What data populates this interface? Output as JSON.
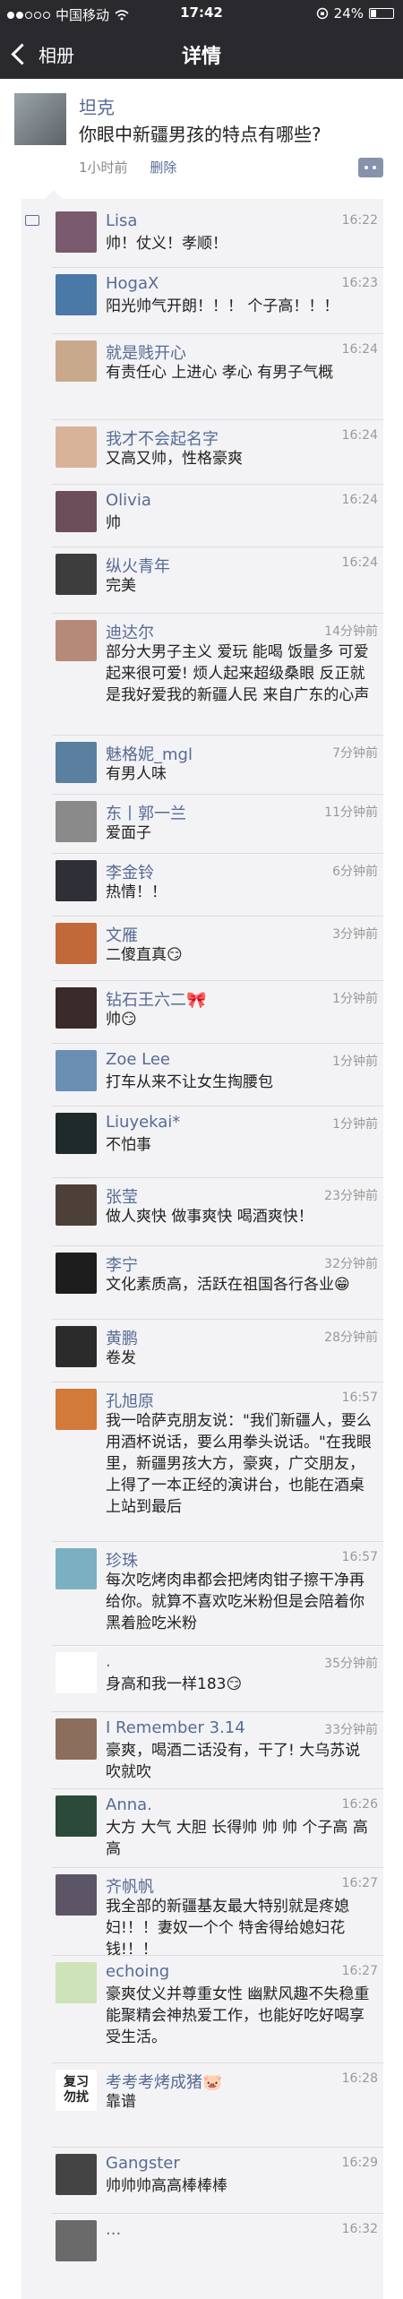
{
  "status": {
    "carrier": "中国移动",
    "time": "17:42",
    "battery": "24%",
    "battery_level": 0.24
  },
  "nav": {
    "back_label": "相册",
    "title": "详情"
  },
  "post": {
    "author": "坦克",
    "text": "你眼中新疆男孩的特点有哪些?",
    "time": "1小时前",
    "delete_label": "删除"
  },
  "comments": [
    {
      "name": "Lisa",
      "time": "16:22",
      "text": "帅！仗义！孝顺！",
      "color": "#7a5a6e"
    },
    {
      "name": "HogaX",
      "time": "16:23",
      "text": "阳光帅气开朗！！！ 个子高！！！",
      "color": "#4a79a8"
    },
    {
      "name": "就是贱开心",
      "time": "16:24",
      "text": "有责任心 上进心 孝心 有男子气概",
      "color": "#c9a98c"
    },
    {
      "name": "我才不会起名字",
      "time": "16:24",
      "text": "又高又帅，性格豪爽",
      "color": "#d8b39a"
    },
    {
      "name": "Olivia",
      "time": "16:24",
      "text": "帅",
      "color": "#6b4e5a"
    },
    {
      "name": "纵火青年",
      "time": "16:24",
      "text": "完美",
      "color": "#3d3d3d"
    },
    {
      "name": "迪达尔",
      "time": "14分钟前",
      "text": "部分大男子主义 爱玩 能喝 饭量多 可爱起来很可爱! 烦人起来超级桑眼 反正就是我好爱我的新疆人民 来自广东的心声",
      "color": "#b58a78"
    },
    {
      "name": "魅格妮_mgl",
      "time": "7分钟前",
      "text": "有男人味",
      "color": "#5b7f9e"
    },
    {
      "name": "东丨郭一兰",
      "time": "11分钟前",
      "text": "爱面子",
      "color": "#8a8a8a"
    },
    {
      "name": "李金铃",
      "time": "6分钟前",
      "text": "热情！！",
      "color": "#2f2f38"
    },
    {
      "name": "文雁",
      "time": "3分钟前",
      "text": "二傻直真😏",
      "color": "#c2693a"
    },
    {
      "name": "钻石王六二🎀",
      "time": "1分钟前",
      "text": "帅😏",
      "color": "#3a2a2a"
    },
    {
      "name": "Zoe Lee",
      "time": "1分钟前",
      "text": "打车从来不让女生掏腰包",
      "color": "#6a8fb3"
    },
    {
      "name": "Liuyekai*",
      "time": "1分钟前",
      "text": "不怕事",
      "color": "#1f2a2a"
    },
    {
      "name": "张莹",
      "time": "23分钟前",
      "text": "做人爽快 做事爽快 喝酒爽快！",
      "color": "#4d4038"
    },
    {
      "name": "李宁",
      "time": "32分钟前",
      "text": "文化素质高，活跃在祖国各行各业😁",
      "color": "#1d1d1d"
    },
    {
      "name": "黄鹏",
      "time": "28分钟前",
      "text": "卷发",
      "color": "#2b2b2b"
    },
    {
      "name": "孔旭原",
      "time": "16:57",
      "text": "我一哈萨克朋友说：\"我们新疆人，要么用酒杯说话，要么用拳头说话。\"在我眼里，新疆男孩大方，豪爽，广交朋友，上得了一本正经的演讲台，也能在酒桌上站到最后",
      "color": "#d27a3a"
    },
    {
      "name": "珍珠",
      "time": "16:57",
      "text": "每次吃烤肉串都会把烤肉钳子擦干净再给你。就算不喜欢吃米粉但是会陪着你黑着脸吃米粉",
      "color": "#7ab0c2"
    },
    {
      "name": ".",
      "time": "35分钟前",
      "text": "身高和我一样183😏",
      "color": "#ffffff"
    },
    {
      "name": "I Remember 3.14",
      "time": "33分钟前",
      "text": "豪爽，喝酒二话没有，干了! 大乌苏说吹就吹",
      "color": "#8b6f5c"
    },
    {
      "name": "Anna.",
      "time": "16:26",
      "text": "大方 大气 大胆 长得帅 帅 帅 个子高 高 高",
      "color": "#2c4a3a"
    },
    {
      "name": "齐帆帆",
      "time": "16:27",
      "text": "我全部的新疆基友最大特别就是疼媳妇!！！妻奴一个个 特舍得给媳妇花钱!！！",
      "color": "#5b5566"
    },
    {
      "name": "echoing",
      "time": "16:27",
      "text": "豪爽仗义并尊重女性 幽默风趣不失稳重 能聚精会神热爱工作，也能好吃好喝享受生活。",
      "color": "#cfe3b8"
    },
    {
      "name": "考考考烤成猪🐷",
      "time": "16:28",
      "text": "靠谱",
      "avatar_text": "复习\n勿扰",
      "color": "#ffffff"
    },
    {
      "name": "Gangster",
      "time": "16:29",
      "text": "帅帅帅高高棒棒棒",
      "color": "#444444"
    },
    {
      "name": "...",
      "time": "16:32",
      "text": "",
      "color": "#6a6a6a"
    }
  ]
}
